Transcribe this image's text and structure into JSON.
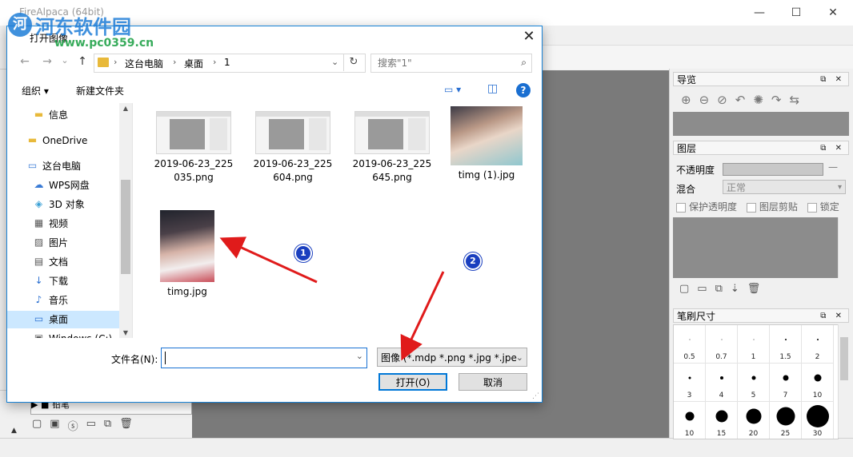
{
  "app": {
    "title": "FireAlpaca (64bit)",
    "window_controls": [
      "—",
      "☐",
      "✕"
    ]
  },
  "watermark": {
    "logo_char": "河",
    "name": "河东软件园",
    "url": "www.pc0359.cn"
  },
  "dialog": {
    "title": "打开图像",
    "close": "✕",
    "nav": {
      "back": "←",
      "forward": "→",
      "chevron": "⌄",
      "up": "↑"
    },
    "breadcrumb": [
      "这台电脑",
      "桌面",
      "1"
    ],
    "breadcrumb_sep": "›",
    "address_dropdown": "⌄",
    "refresh": "↻",
    "search": {
      "placeholder": "搜索\"1\"",
      "icon": "⌕"
    },
    "toolbar": {
      "organize": "组织 ▾",
      "new_folder": "新建文件夹",
      "view_icon": "▭ ▾",
      "pane_icon": "◫",
      "help": "?"
    },
    "tree": [
      {
        "label": "信息",
        "icon": "▬",
        "indent": 1,
        "color": "#e8b93a"
      },
      {
        "label": "OneDrive",
        "icon": "▬",
        "indent": 0,
        "color": "#e8b93a"
      },
      {
        "label": "这台电脑",
        "icon": "▭",
        "indent": 0,
        "color": "#3a7bd5"
      },
      {
        "label": "WPS网盘",
        "icon": "☁",
        "indent": 1,
        "color": "#3a7bd5"
      },
      {
        "label": "3D 对象",
        "icon": "◈",
        "indent": 1,
        "color": "#3aa0d5"
      },
      {
        "label": "视频",
        "icon": "▦",
        "indent": 1,
        "color": "#555"
      },
      {
        "label": "图片",
        "icon": "▨",
        "indent": 1,
        "color": "#555"
      },
      {
        "label": "文档",
        "icon": "▤",
        "indent": 1,
        "color": "#555"
      },
      {
        "label": "下载",
        "icon": "↓",
        "indent": 1,
        "color": "#2a6fd1"
      },
      {
        "label": "音乐",
        "icon": "♪",
        "indent": 1,
        "color": "#2a6fd1"
      },
      {
        "label": "桌面",
        "icon": "▭",
        "indent": 1,
        "color": "#2a6fd1",
        "selected": true
      },
      {
        "label": "Windows (C:)",
        "icon": "▣",
        "indent": 1,
        "color": "#555"
      }
    ],
    "files": [
      {
        "name_line1": "2019-06-23_225",
        "name_line2": "035.png",
        "kind": "screenshot"
      },
      {
        "name_line1": "2019-06-23_225",
        "name_line2": "604.png",
        "kind": "screenshot"
      },
      {
        "name_line1": "2019-06-23_225",
        "name_line2": "645.png",
        "kind": "screenshot"
      },
      {
        "name_line1": "timg (1).jpg",
        "name_line2": "",
        "kind": "photo"
      },
      {
        "name_line1": "timg.jpg",
        "name_line2": "",
        "kind": "photo2"
      }
    ],
    "filename_label": "文件名(N):",
    "filename_value": "",
    "filetype_value": "图像 (*.mdp *.png *.jpg *.jpe",
    "open_button": "打开(O)",
    "cancel_button": "取消"
  },
  "annotations": {
    "badge1": "1",
    "badge2": "2",
    "arrow_color": "#e01b1b"
  },
  "panels": {
    "navigator": {
      "title": "导览",
      "controls": "⧉ ✕",
      "icons": [
        "⊕",
        "⊖",
        "⊘",
        "↶",
        "✺",
        "↷",
        "⇆"
      ]
    },
    "layers": {
      "title": "图层",
      "controls": "⧉ ✕",
      "opacity_label": "不透明度",
      "opacity_value_text": "—",
      "blend_label": "混合",
      "blend_value": "正常",
      "protect_alpha": "保护透明度",
      "clipping": "图层剪贴",
      "lock": "锁定",
      "icons": [
        "▢",
        "▭",
        "⧉",
        "⇣",
        "🗑"
      ]
    },
    "brush": {
      "title": "笔刷尺寸",
      "controls": "⧉ ✕",
      "sizes": [
        "0.5",
        "0.7",
        "1",
        "1.5",
        "2",
        "3",
        "4",
        "5",
        "7",
        "10",
        "10",
        "15",
        "20",
        "25",
        "30"
      ]
    }
  },
  "left_panel": {
    "row_text": "▶ ■  铅笔",
    "icons": [
      "▢",
      "▣",
      "ⓢ",
      "▭",
      "⧉",
      "🗑"
    ]
  }
}
